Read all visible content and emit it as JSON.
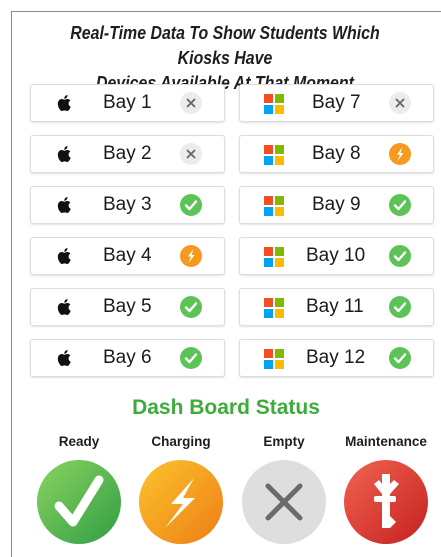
{
  "title_line1": "Real-Time Data To Show Students Which Kiosks Have",
  "title_line2": "Devices Available At That Moment",
  "bays": [
    {
      "label": "Bay 1",
      "os": "apple-icon",
      "status": "empty"
    },
    {
      "label": "Bay 2",
      "os": "apple-icon",
      "status": "empty"
    },
    {
      "label": "Bay 3",
      "os": "apple-icon",
      "status": "ready"
    },
    {
      "label": "Bay 4",
      "os": "apple-icon",
      "status": "charging"
    },
    {
      "label": "Bay 5",
      "os": "apple-icon",
      "status": "ready"
    },
    {
      "label": "Bay 6",
      "os": "apple-icon",
      "status": "ready"
    },
    {
      "label": "Bay 7",
      "os": "windows-icon",
      "status": "empty"
    },
    {
      "label": "Bay 8",
      "os": "windows-icon",
      "status": "charging"
    },
    {
      "label": "Bay 9",
      "os": "windows-icon",
      "status": "ready"
    },
    {
      "label": "Bay 10",
      "os": "windows-icon",
      "status": "ready"
    },
    {
      "label": "Bay 11",
      "os": "windows-icon",
      "status": "ready"
    },
    {
      "label": "Bay 12",
      "os": "windows-icon",
      "status": "ready"
    }
  ],
  "dashboard": {
    "heading": "Dash Board Status",
    "legend": [
      {
        "key": "ready",
        "label": "Ready",
        "icon": "checkmark-icon"
      },
      {
        "key": "charging",
        "label": "Charging",
        "icon": "lightning-icon"
      },
      {
        "key": "empty",
        "label": "Empty",
        "icon": "x-icon"
      },
      {
        "key": "maintenance",
        "label": "Maintenance",
        "icon": "wrench-icon"
      }
    ]
  },
  "colors": {
    "ready": "#5cc457",
    "charging": "#f59a1e",
    "empty": "#d6d6d6",
    "maintenance": "#e03b2e",
    "heading": "#3dac3a"
  }
}
